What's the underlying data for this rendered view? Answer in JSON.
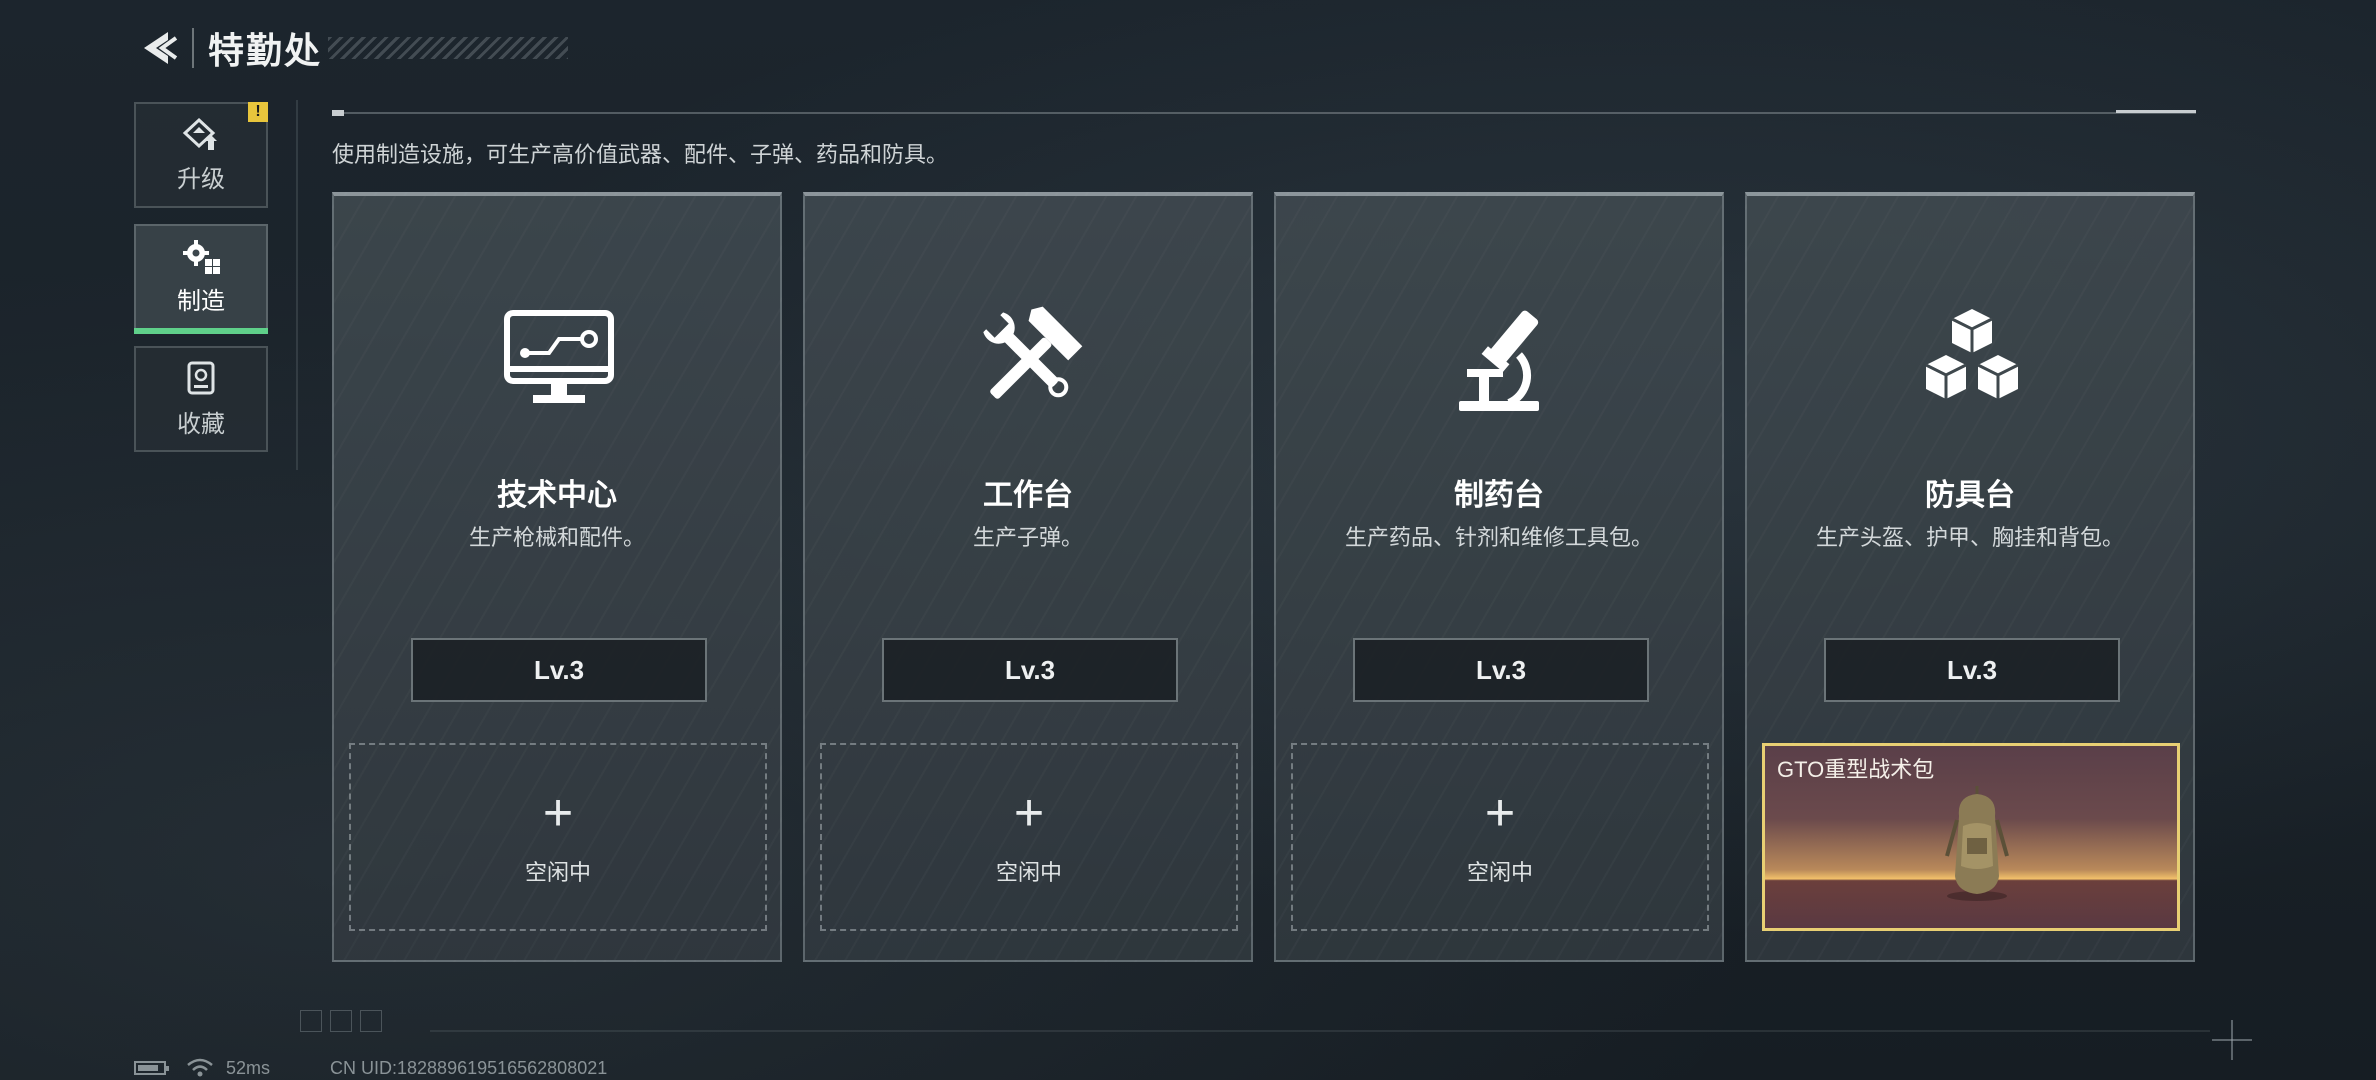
{
  "header": {
    "title": "特勤处"
  },
  "sidebar": {
    "items": [
      {
        "label": "升级",
        "icon": "upgrade-icon",
        "alert": "!"
      },
      {
        "label": "制造",
        "icon": "gears-icon",
        "active": true
      },
      {
        "label": "收藏",
        "icon": "collection-icon"
      }
    ]
  },
  "description": "使用制造设施，可生产高价值武器、配件、子弹、药品和防具。",
  "stations": [
    {
      "name": "技术中心",
      "desc": "生产枪械和配件。",
      "level": "Lv.3",
      "icon": "monitor-circuit-icon",
      "slot": {
        "status": "空闲中",
        "plus": "+"
      }
    },
    {
      "name": "工作台",
      "desc": "生产子弹。",
      "level": "Lv.3",
      "icon": "hammer-wrench-icon",
      "slot": {
        "status": "空闲中",
        "plus": "+"
      }
    },
    {
      "name": "制药台",
      "desc": "生产药品、针剂和维修工具包。",
      "level": "Lv.3",
      "icon": "microscope-icon",
      "slot": {
        "status": "空闲中",
        "plus": "+"
      }
    },
    {
      "name": "防具台",
      "desc": "生产头盔、护甲、胸挂和背包。",
      "level": "Lv.3",
      "icon": "cubes-icon",
      "slot": {
        "item": "GTO重型战术包",
        "item_icon": "backpack-icon"
      }
    }
  ],
  "status_bar": {
    "ping": "52ms",
    "uid": "CN UID:182889619516562808021"
  },
  "colors": {
    "active_indicator": "#5fd08a",
    "alert": "#e8c53c",
    "item_border": "#e8cf73"
  }
}
